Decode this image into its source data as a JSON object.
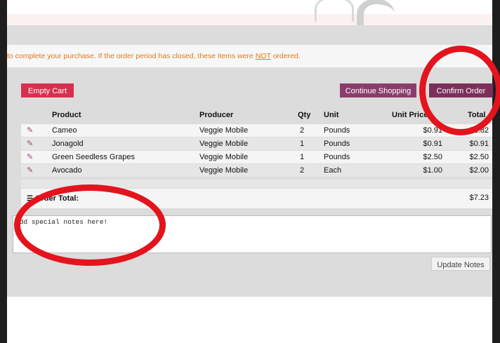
{
  "notice": {
    "text_before": "to complete your purchase. If the order period has closed, these items were ",
    "underlined": "NOT",
    "text_after": " ordered."
  },
  "buttons": {
    "empty_cart": "Empty Cart",
    "continue_shopping": "Continue Shopping",
    "confirm_order": "Confirm Order",
    "update_notes": "Update Notes"
  },
  "table": {
    "headers": {
      "product": "Product",
      "producer": "Producer",
      "qty": "Qty",
      "unit": "Unit",
      "unit_price": "Unit Price",
      "total": "Total"
    },
    "rows": [
      {
        "product": "Cameo",
        "producer": "Veggie Mobile",
        "qty": "2",
        "unit": "Pounds",
        "unit_price": "$0.91",
        "total": "$1.82"
      },
      {
        "product": "Jonagold",
        "producer": "Veggie Mobile",
        "qty": "1",
        "unit": "Pounds",
        "unit_price": "$0.91",
        "total": "$0.91"
      },
      {
        "product": "Green Seedless Grapes",
        "producer": "Veggie Mobile",
        "qty": "1",
        "unit": "Pounds",
        "unit_price": "$2.50",
        "total": "$2.50"
      },
      {
        "product": "Avocado",
        "producer": "Veggie Mobile",
        "qty": "2",
        "unit": "Each",
        "unit_price": "$1.00",
        "total": "$2.00"
      }
    ]
  },
  "order_total": {
    "label": "Order Total:",
    "value": "$7.23"
  },
  "notes": {
    "placeholder": "Add special notes here!"
  },
  "colors": {
    "empty_cart": "#d6304e",
    "continue_shopping": "#8a3d6b",
    "confirm_order": "#7b2f5a",
    "notice_text": "#e07a18",
    "annotation_circle": "#e3141d"
  },
  "icons": {
    "edit": "pencil-square-icon",
    "order_total": "list-icon"
  }
}
